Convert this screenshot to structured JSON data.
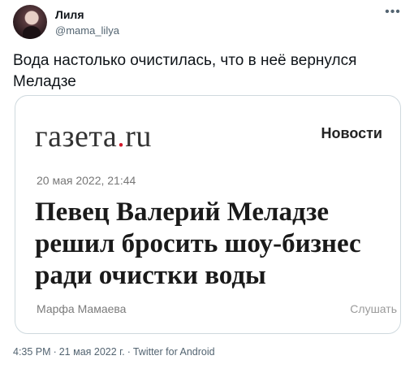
{
  "user": {
    "display_name": "Лиля",
    "handle": "@mama_lilya"
  },
  "more_icon": "more-horizontal-icon",
  "tweet": {
    "text": "Вода настолько очистилась, что в неё вернулся Меладзе"
  },
  "card": {
    "logo_main": "газета",
    "logo_dot": ".",
    "logo_tld": "ru",
    "logo_dot_color": "#d1192b",
    "section": "Новости",
    "date": "20 мая 2022, 21:44",
    "headline": "Певец Валерий Меладзе решил бросить шоу-бизнес ради очистки воды",
    "author": "Марфа Мамаева",
    "listen": "Слушать"
  },
  "meta": {
    "time": "4:35 PM",
    "separator": "·",
    "date": "21 мая 2022 г.",
    "source": "Twitter for Android"
  }
}
